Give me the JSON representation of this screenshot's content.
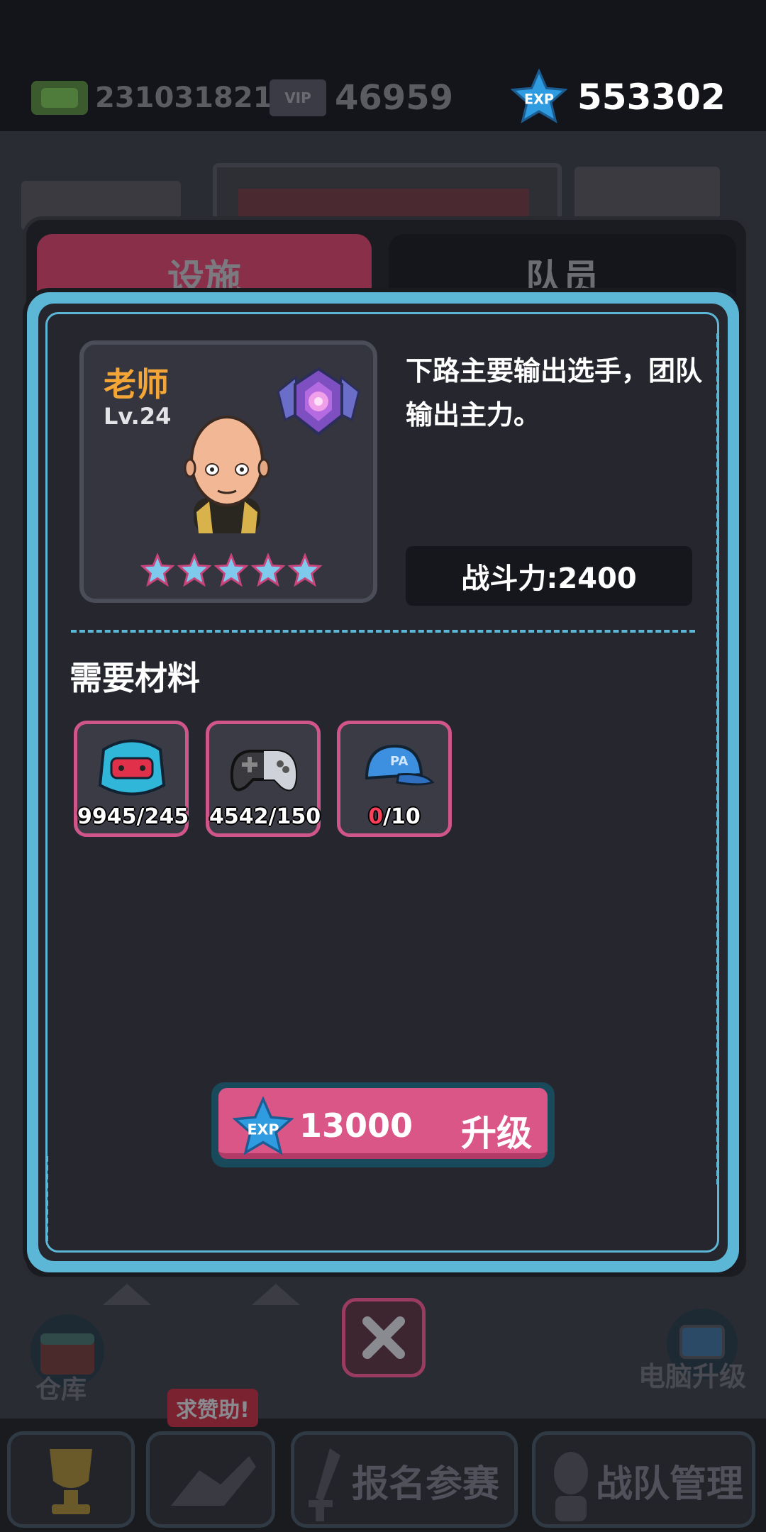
{
  "currencies": {
    "cash": {
      "icon": "cash-icon",
      "value": "231031821"
    },
    "vip": {
      "icon": "vip-ticket-icon",
      "label": "VIP",
      "value": "46959"
    },
    "exp": {
      "icon": "exp-star-icon",
      "label": "EXP",
      "value": "553302"
    }
  },
  "tabs": [
    {
      "label": "设施",
      "active": false
    },
    {
      "label": "队员",
      "active": true
    }
  ],
  "character": {
    "name": "老师",
    "level": "Lv.24",
    "stars": 5,
    "description": "下路主要输出选手，团队输出主力。",
    "power": "战斗力:2400"
  },
  "materials": {
    "title": "需要材料",
    "items": [
      {
        "name": "steering-wheel-controller",
        "have": "9945",
        "need": "/245",
        "enough": true
      },
      {
        "name": "gamepad",
        "have": "4542",
        "need": "/150",
        "enough": true
      },
      {
        "name": "cap",
        "have": "0",
        "need": "/10",
        "enough": false
      }
    ]
  },
  "upgrade": {
    "exp_label": "EXP",
    "cost": "13000",
    "label": "升级"
  },
  "bottom": {
    "warehouse": "仓库",
    "pc_upgrade": "电脑升级",
    "help_tag": "求赞助!",
    "nav": [
      "报名参赛",
      "战队管理"
    ]
  },
  "colors": {
    "accent": "#5cb7d6",
    "button": "#d95687",
    "name": "#f3a637",
    "material_border": "#d0558a"
  }
}
